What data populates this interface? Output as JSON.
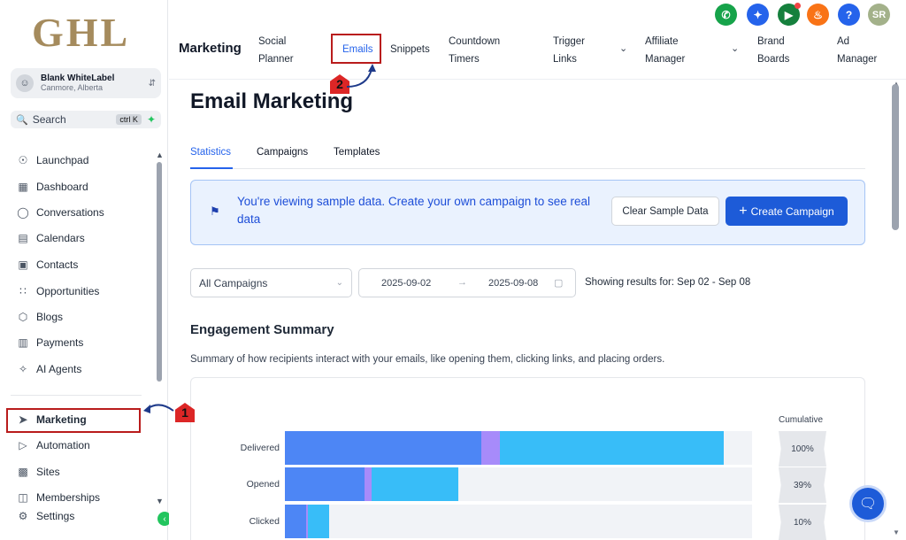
{
  "brand": {
    "logo_text": "GHL"
  },
  "account": {
    "name": "Blank WhiteLabel",
    "location": "Canmore, Alberta",
    "avatar_icon": "user-icon"
  },
  "search": {
    "placeholder": "Search",
    "shortcut": "ctrl K"
  },
  "sidebar": {
    "items": [
      {
        "label": "Launchpad",
        "icon": "rocket-icon"
      },
      {
        "label": "Dashboard",
        "icon": "grid-icon"
      },
      {
        "label": "Conversations",
        "icon": "chat-icon"
      },
      {
        "label": "Calendars",
        "icon": "calendar-icon"
      },
      {
        "label": "Contacts",
        "icon": "contacts-icon"
      },
      {
        "label": "Opportunities",
        "icon": "opportunities-icon"
      },
      {
        "label": "Blogs",
        "icon": "cube-icon"
      },
      {
        "label": "Payments",
        "icon": "payments-icon"
      },
      {
        "label": "AI Agents",
        "icon": "sparkle-icon"
      },
      {
        "label": "Marketing",
        "icon": "send-icon"
      },
      {
        "label": "Automation",
        "icon": "automation-icon"
      },
      {
        "label": "Sites",
        "icon": "sites-icon"
      },
      {
        "label": "Memberships",
        "icon": "memberships-icon"
      },
      {
        "label": "Settings",
        "icon": "gear-icon"
      }
    ],
    "active": "Marketing"
  },
  "header": {
    "title": "Marketing",
    "tabs": [
      {
        "label": "Social\nPlanner"
      },
      {
        "label": "Emails",
        "active": true
      },
      {
        "label": "Snippets"
      },
      {
        "label": "Countdown\nTimers"
      },
      {
        "label": "Trigger\nLinks",
        "dropdown": true
      },
      {
        "label": "Affiliate\nManager",
        "dropdown": true
      },
      {
        "label": "Brand\nBoards"
      },
      {
        "label": "Ad\nManager"
      }
    ],
    "icons": [
      {
        "name": "phone-icon",
        "color": "#16a34a"
      },
      {
        "name": "magic-icon",
        "color": "#2563eb"
      },
      {
        "name": "megaphone-icon",
        "color": "#15803d"
      },
      {
        "name": "bell-icon",
        "color": "#f97316"
      },
      {
        "name": "help-icon",
        "color": "#2563eb"
      },
      {
        "name": "user-avatar",
        "color": "#a3b18a",
        "text": "SR"
      }
    ]
  },
  "page": {
    "title": "Email Marketing",
    "subtabs": [
      "Statistics",
      "Campaigns",
      "Templates"
    ],
    "active_subtab": "Statistics"
  },
  "banner": {
    "text": "You're viewing sample data. Create your own campaign to see real data",
    "clear_button": "Clear Sample Data",
    "create_button": "Create Campaign"
  },
  "filters": {
    "campaign_select": "All Campaigns",
    "date_start": "2025-09-02",
    "date_end": "2025-09-08",
    "results_text": "Showing results for: Sep 02 - Sep 08"
  },
  "engagement": {
    "title": "Engagement Summary",
    "description": "Summary of how recipients interact with your emails, like opening them, clicking links, and placing orders.",
    "cumulative_label": "Cumulative",
    "rows": [
      {
        "label": "Delivered",
        "cumulative": "100%",
        "segments": [
          {
            "fraction": 0.42,
            "color": "#4d86f5"
          },
          {
            "fraction": 0.04,
            "color": "#a78bfa"
          },
          {
            "fraction": 0.48,
            "color": "#38bdf8"
          }
        ]
      },
      {
        "label": "Opened",
        "cumulative": "39%",
        "segments": [
          {
            "fraction": 0.17,
            "color": "#4d86f5"
          },
          {
            "fraction": 0.015,
            "color": "#a78bfa"
          },
          {
            "fraction": 0.185,
            "color": "#38bdf8"
          }
        ]
      },
      {
        "label": "Clicked",
        "cumulative": "10%",
        "segments": [
          {
            "fraction": 0.045,
            "color": "#4d86f5"
          },
          {
            "fraction": 0.005,
            "color": "#a78bfa"
          },
          {
            "fraction": 0.045,
            "color": "#38bdf8"
          }
        ]
      }
    ]
  },
  "annotations": {
    "step1": "1",
    "step2": "2"
  },
  "colors": {
    "accent": "#1d5bd8",
    "annotation": "#dc2626"
  }
}
